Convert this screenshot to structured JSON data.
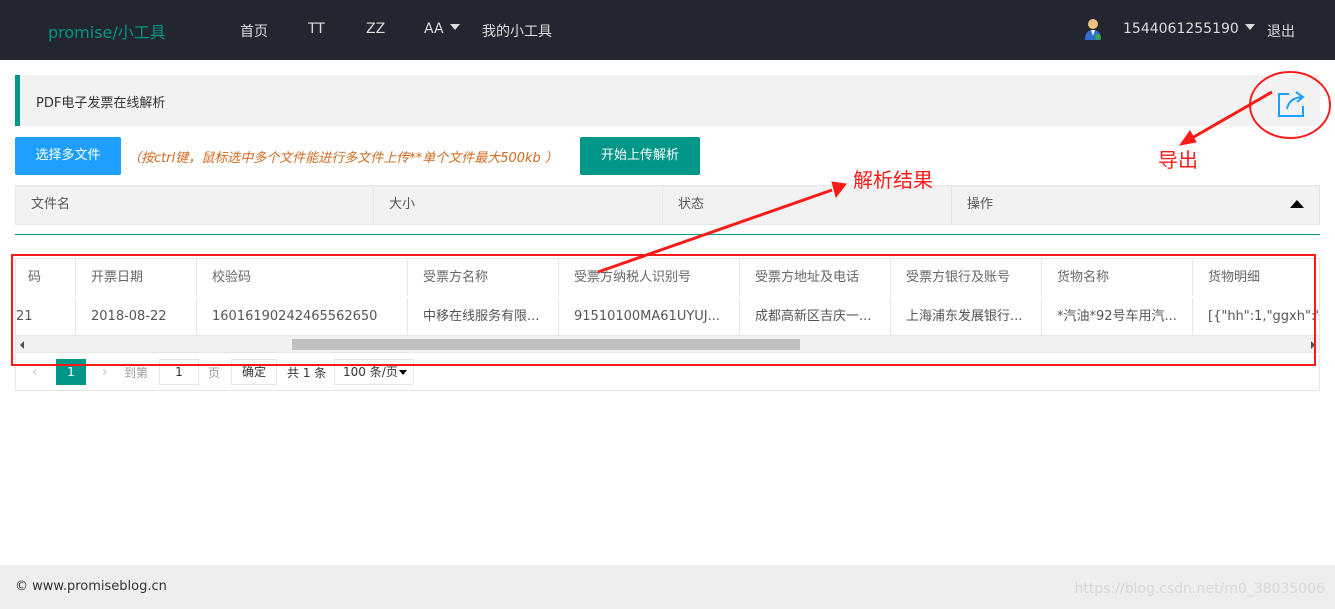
{
  "nav": {
    "brand": "promise/小工具",
    "items": [
      "首页",
      "TT",
      "ZZ",
      "AA",
      "我的小工具"
    ],
    "user": "1544061255190",
    "logout": "退出"
  },
  "page": {
    "title": "PDF电子发票在线解析"
  },
  "upload": {
    "select_label": "选择多文件",
    "hint": "（按ctrl键，鼠标选中多个文件能进行多文件上传**单个文件最大500kb ）",
    "upload_label": "开始上传解析"
  },
  "file_list": {
    "columns": [
      "文件名",
      "大小",
      "状态",
      "操作"
    ]
  },
  "result": {
    "columns": [
      "码",
      "开票日期",
      "校验码",
      "受票方名称",
      "受票方纳税人识别号",
      "受票方地址及电话",
      "受票方银行及账号",
      "货物名称",
      "货物明细"
    ],
    "rows": [
      [
        "21",
        "2018-08-22",
        "16016190242465562650",
        "中移在线服务有限...",
        "91510100MA61UYUJ...",
        "成都高新区吉庆一...",
        "上海浦东发展银行...",
        "*汽油*92号车用汽...",
        "[{\"hh\":1,\"ggxh\":\"\""
      ]
    ]
  },
  "pager": {
    "prev": "‹",
    "current": "1",
    "next": "›",
    "goto_label": "到第",
    "page_value": "1",
    "page_unit": "页",
    "confirm": "确定",
    "total": "共 1 条",
    "page_size": "100 条/页"
  },
  "footer": {
    "copyright": "© www.promiseblog.cn",
    "watermark": "https://blog.csdn.net/m0_38035006"
  },
  "annotations": {
    "export": "导出",
    "result": "解析结果",
    "color": "#ff1a1a"
  },
  "colors": {
    "nav_bg": "#23262e",
    "accent": "#009688",
    "primary_blue": "#1e9fff"
  }
}
